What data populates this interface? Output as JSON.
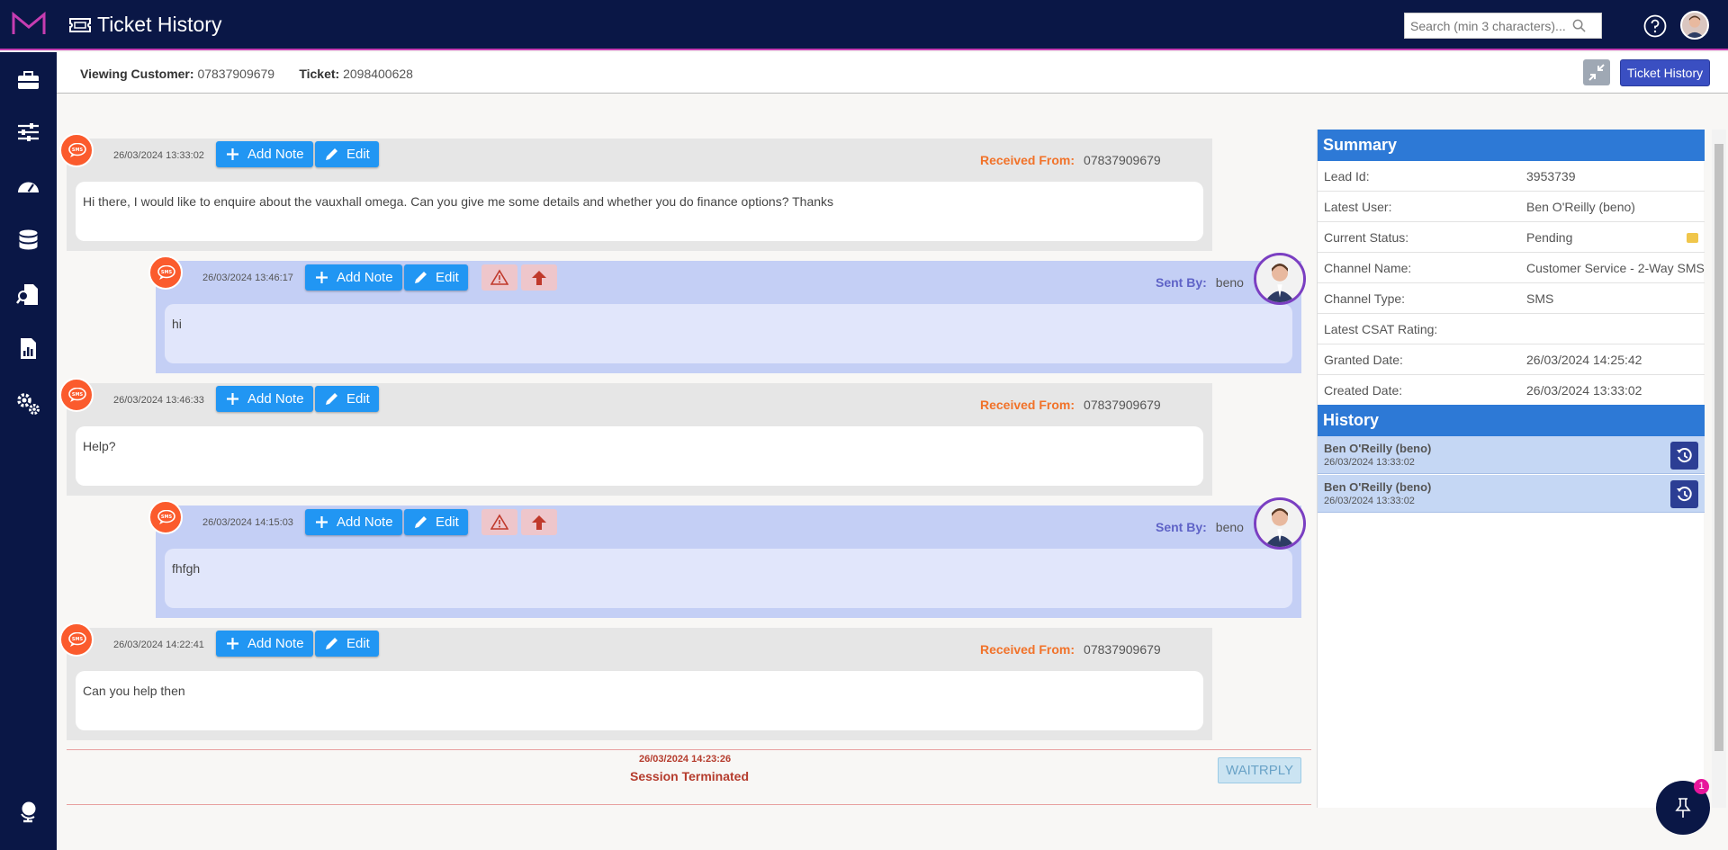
{
  "header": {
    "title": "Ticket History",
    "search_placeholder": "Search (min 3 characters)..."
  },
  "subheader": {
    "customer_label": "Viewing Customer:",
    "customer_value": "07837909679",
    "ticket_label": "Ticket:",
    "ticket_value": "2098400628",
    "ticket_history_button": "Ticket History"
  },
  "buttons": {
    "add_note": "Add Note",
    "edit": "Edit"
  },
  "messages": [
    {
      "direction": "in",
      "time": "26/03/2024 13:33:02",
      "label": "Received From:",
      "from": "07837909679",
      "text": "Hi there, I would like to enquire about the vauxhall omega. Can you give me some details and whether you do finance options? Thanks"
    },
    {
      "direction": "out",
      "time": "26/03/2024 13:46:17",
      "label": "Sent By:",
      "from": "beno",
      "text": "hi"
    },
    {
      "direction": "in",
      "time": "26/03/2024 13:46:33",
      "label": "Received From:",
      "from": "07837909679",
      "text": "Help?"
    },
    {
      "direction": "out",
      "time": "26/03/2024 14:15:03",
      "label": "Sent By:",
      "from": "beno",
      "text": "fhfgh"
    },
    {
      "direction": "in",
      "time": "26/03/2024 14:22:41",
      "label": "Received From:",
      "from": "07837909679",
      "text": "Can you help then"
    }
  ],
  "session": {
    "date": "26/03/2024 14:23:26",
    "text": "Session Terminated",
    "status_badge": "WAITRPLY"
  },
  "summary": {
    "title": "Summary",
    "rows": [
      {
        "key": "Lead Id:",
        "value": "3953739"
      },
      {
        "key": "Latest User:",
        "value": "Ben O'Reilly (beno)"
      },
      {
        "key": "Current Status:",
        "value": "Pending"
      },
      {
        "key": "Channel Name:",
        "value": "Customer Service - 2-Way SMS"
      },
      {
        "key": "Channel Type:",
        "value": "SMS"
      },
      {
        "key": "Latest CSAT Rating:",
        "value": ""
      },
      {
        "key": "Granted Date:",
        "value": "26/03/2024 14:25:42"
      },
      {
        "key": "Created Date:",
        "value": "26/03/2024 13:33:02"
      }
    ]
  },
  "history": {
    "title": "History",
    "items": [
      {
        "name": "Ben O'Reilly (beno)",
        "date": "26/03/2024 13:33:02"
      },
      {
        "name": "Ben O'Reilly (beno)",
        "date": "26/03/2024 13:33:02"
      }
    ]
  },
  "pin_badge_count": "1",
  "colors": {
    "navy": "#0a1746",
    "accent_pink": "#c63db1",
    "primary_blue": "#2196f3",
    "panel_blue": "#2d79d6",
    "sms_orange": "#fb5b2d"
  }
}
